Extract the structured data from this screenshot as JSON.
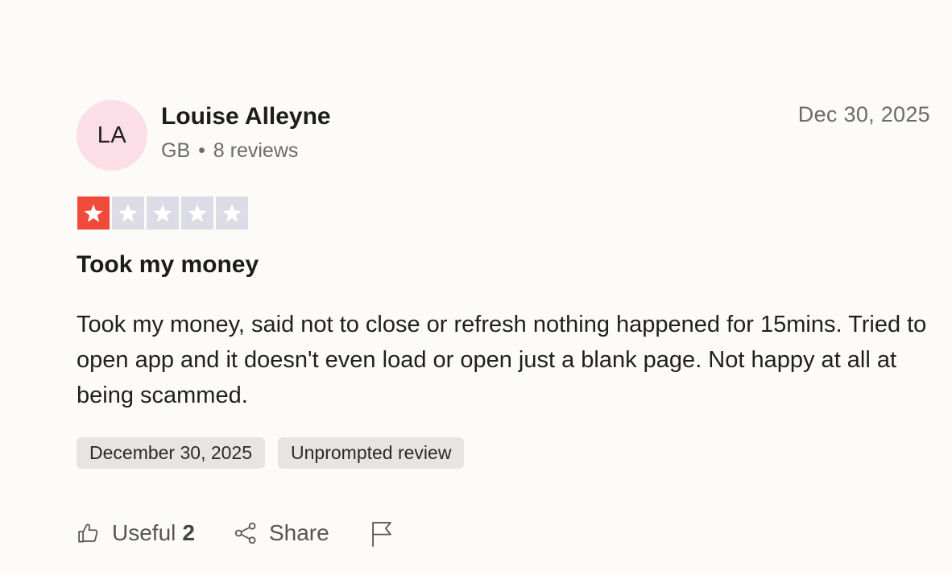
{
  "reviewer": {
    "initials": "LA",
    "name": "Louise Alleyne",
    "country": "GB",
    "separator": "•",
    "reviews_count": "8 reviews"
  },
  "review": {
    "date": "Dec 30, 2025",
    "rating": 1,
    "max_rating": 5,
    "title": "Took my money",
    "body": "Took my money, said not to close or refresh nothing happened for 15mins. Tried to open app and it doesn't even load or open just a blank page. Not happy at all at being scammed."
  },
  "tags": [
    "December 30, 2025",
    "Unprompted review"
  ],
  "actions": {
    "useful_label": "Useful",
    "useful_count": "2",
    "share_label": "Share"
  },
  "icons": {
    "useful": "thumbs-up-icon",
    "share": "share-icon",
    "report": "flag-icon",
    "star": "star-icon"
  },
  "colors": {
    "star_filled": "#f04a3a",
    "star_empty": "#dcdce6",
    "avatar_bg": "#fbdee8",
    "tag_bg": "#e6e5e3"
  }
}
